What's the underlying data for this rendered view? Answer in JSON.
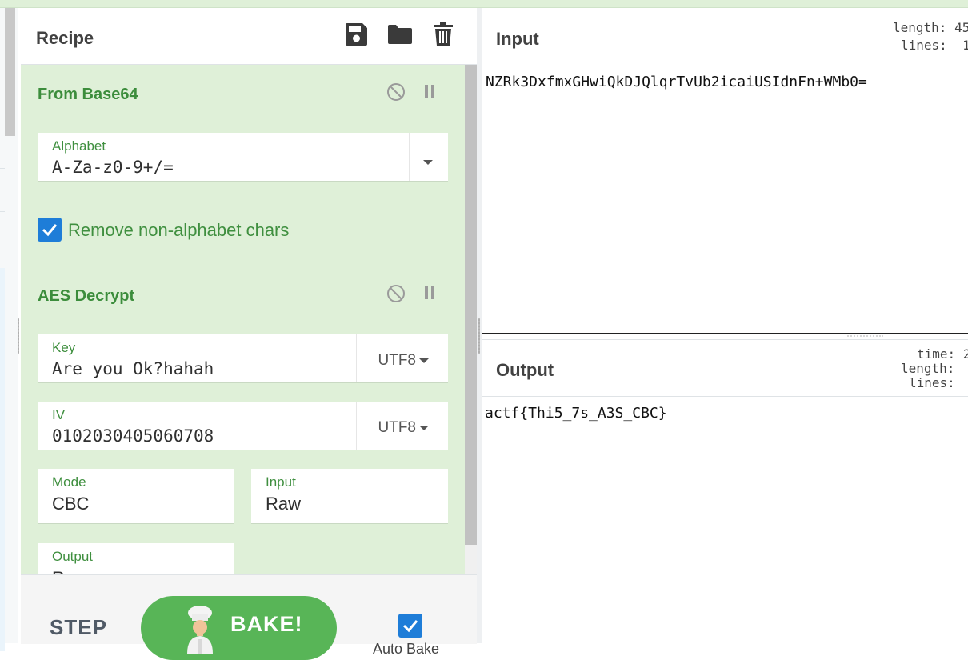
{
  "recipe": {
    "title": "Recipe",
    "icons": [
      "save-icon",
      "folder-icon",
      "trash-icon"
    ],
    "operations": [
      {
        "name": "From Base64",
        "alphabet_label": "Alphabet",
        "alphabet_value": "A-Za-z0-9+/=",
        "remove_label": "Remove non-alphabet chars",
        "remove_checked": true
      },
      {
        "name": "AES Decrypt",
        "key_label": "Key",
        "key_value": "Are_you_Ok?hahah",
        "key_encoding": "UTF8",
        "iv_label": "IV",
        "iv_value": "0102030405060708",
        "iv_encoding": "UTF8",
        "mode_label": "Mode",
        "mode_value": "CBC",
        "input_label": "Input",
        "input_value": "Raw",
        "output_label": "Output",
        "output_value": "Raw"
      }
    ]
  },
  "controls": {
    "step_label": "STEP",
    "bake_label": "BAKE!",
    "autobake_label": "Auto Bake",
    "autobake_checked": true
  },
  "input": {
    "title": "Input",
    "length_label": "length: 45",
    "lines_label": "lines:  1",
    "text": "NZRk3DxfmxGHwiQkDJQlqrTvUb2icaiUSIdnFn+WMb0="
  },
  "output": {
    "title": "Output",
    "time_label": "time: 2",
    "length_label": "length:",
    "lines_label": "lines:",
    "text": "actf{Thi5_7s_A3S_CBC}"
  },
  "colors": {
    "recipe_bg": "#dff0d8",
    "accent_green": "#3f8f3f",
    "bake_green": "#58b557",
    "checkbox_blue": "#1e7dd8"
  }
}
